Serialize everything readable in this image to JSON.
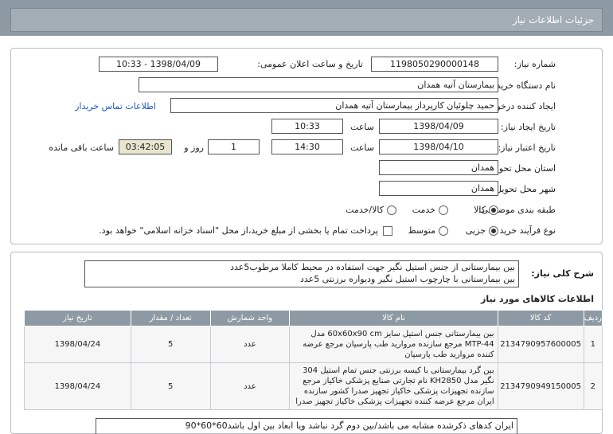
{
  "header": {
    "title": "جزئیات اطلاعات نیاز"
  },
  "form": {
    "need_number_label": "شماره نیاز:",
    "need_number": "1198050290000148",
    "announce_label": "تاریخ و ساعت اعلان عمومی:",
    "announce_value": "1398/04/09 - 10:33",
    "buyer_org_label": "نام دستگاه خریدار:",
    "buyer_org": "بیمارستان آتیه همدان",
    "requester_label": "ایجاد کننده درخواست:",
    "requester": "حمید چلوئیان  کارپرداز بیمارستان آتیه همدان",
    "contact_link": "اطلاعات تماس خریدار",
    "created_label": "تاریخ ایجاد نیاز:",
    "created_date": "1398/04/09",
    "time_label": "ساعت",
    "created_time": "10:33",
    "validity_label": "تاریخ اعتبار نیاز:",
    "validity_date": "1398/04/10",
    "validity_time": "14:30",
    "days_value": "1",
    "days_label": "روز و",
    "remaining_time": "03:42:05",
    "remaining_label": "ساعت باقی مانده",
    "province_label": "استان محل تحویل:",
    "province": "همدان",
    "city_label": "شهر محل تحویل:",
    "city": "همدان",
    "category_label": "طبقه بندی موضوعی:",
    "category_options": [
      "کالا",
      "خدمت",
      "کالا/خدمت"
    ],
    "process_label": "نوع فرآیند خرید :",
    "process_options": [
      "جزیی",
      "متوسط"
    ],
    "payment_note": "پرداخت تمام یا بخشی از مبلغ خرید،از محل \"اسناد خزانه اسلامی\" خواهد بود."
  },
  "description": {
    "label": "شرح کلی نیاز:",
    "line1": "بین بیمارستانی از جنس استیل نگیر جهت استفاده در محیط کاملا مرطوب5عدد",
    "line2": "بین بیمارستانی با چارچوب استیل نگیر ودیواره برزنتی 5عدد"
  },
  "items": {
    "title": "اطلاعات کالاهای مورد نیاز",
    "columns": [
      "ردیف",
      "کد کالا",
      "نام کالا",
      "واحد شمارش",
      "تعداد / مقدار",
      "تاریخ نیاز"
    ],
    "rows": [
      {
        "row": "1",
        "code": "2134790957600005",
        "name": "بین بیمارستانی جنس استیل سایز 60x60x90 cm مدل MTP-44 مرجع سازنده مروارید طب پارسیان مرجع عرضه کننده مروارید طب پارسیان",
        "unit": "عدد",
        "qty": "5",
        "date": "1398/04/24"
      },
      {
        "row": "2",
        "code": "2134790949150005",
        "name": "بین گرد بیمارستانی با کیسه برزنتی جنس تمام استیل 304 نگیر مدل KH2850 نام تجارتی صنایع پزشکی خاکیاز مرجع سازنده تجهیزات پزشکی خاکیاز تجهیز صدرا کشور سازنده ایران مرجع عرضه کننده تجهیزات پزشکی خاکیاز تجهیز صدرا",
        "unit": "عدد",
        "qty": "5",
        "date": "1398/04/24"
      }
    ]
  },
  "note": "ایران کدهای ذکرشده مشابه می باشد/بین دوم گرد نباشد ویا ابعاد بین اول باشد60*60*90"
}
